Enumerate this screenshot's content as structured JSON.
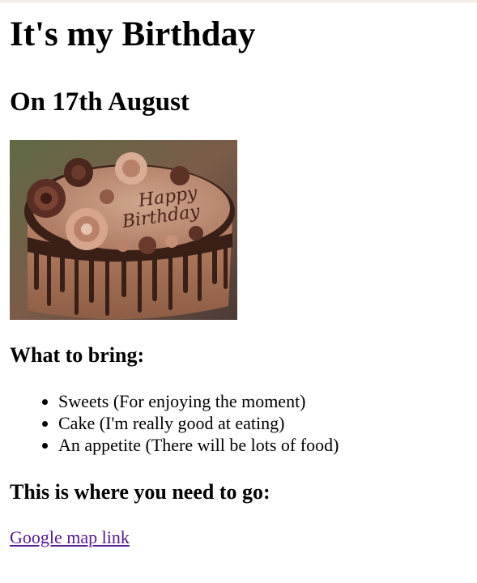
{
  "page": {
    "title": "It's my Birthday",
    "subtitle": "On 17th August"
  },
  "image": {
    "icon": "birthday-cake-photo",
    "text": "Happy Birthday"
  },
  "bring": {
    "heading": "What to bring:",
    "items": [
      "Sweets (For enjoying the moment)",
      "Cake (I'm really good at eating)",
      "An appetite (There will be lots of food)"
    ]
  },
  "directions": {
    "heading": "This is where you need to go:",
    "link_label": "Google map link"
  },
  "colors": {
    "link_visited": "#551a8b",
    "top_strip": "#f3ece1"
  }
}
